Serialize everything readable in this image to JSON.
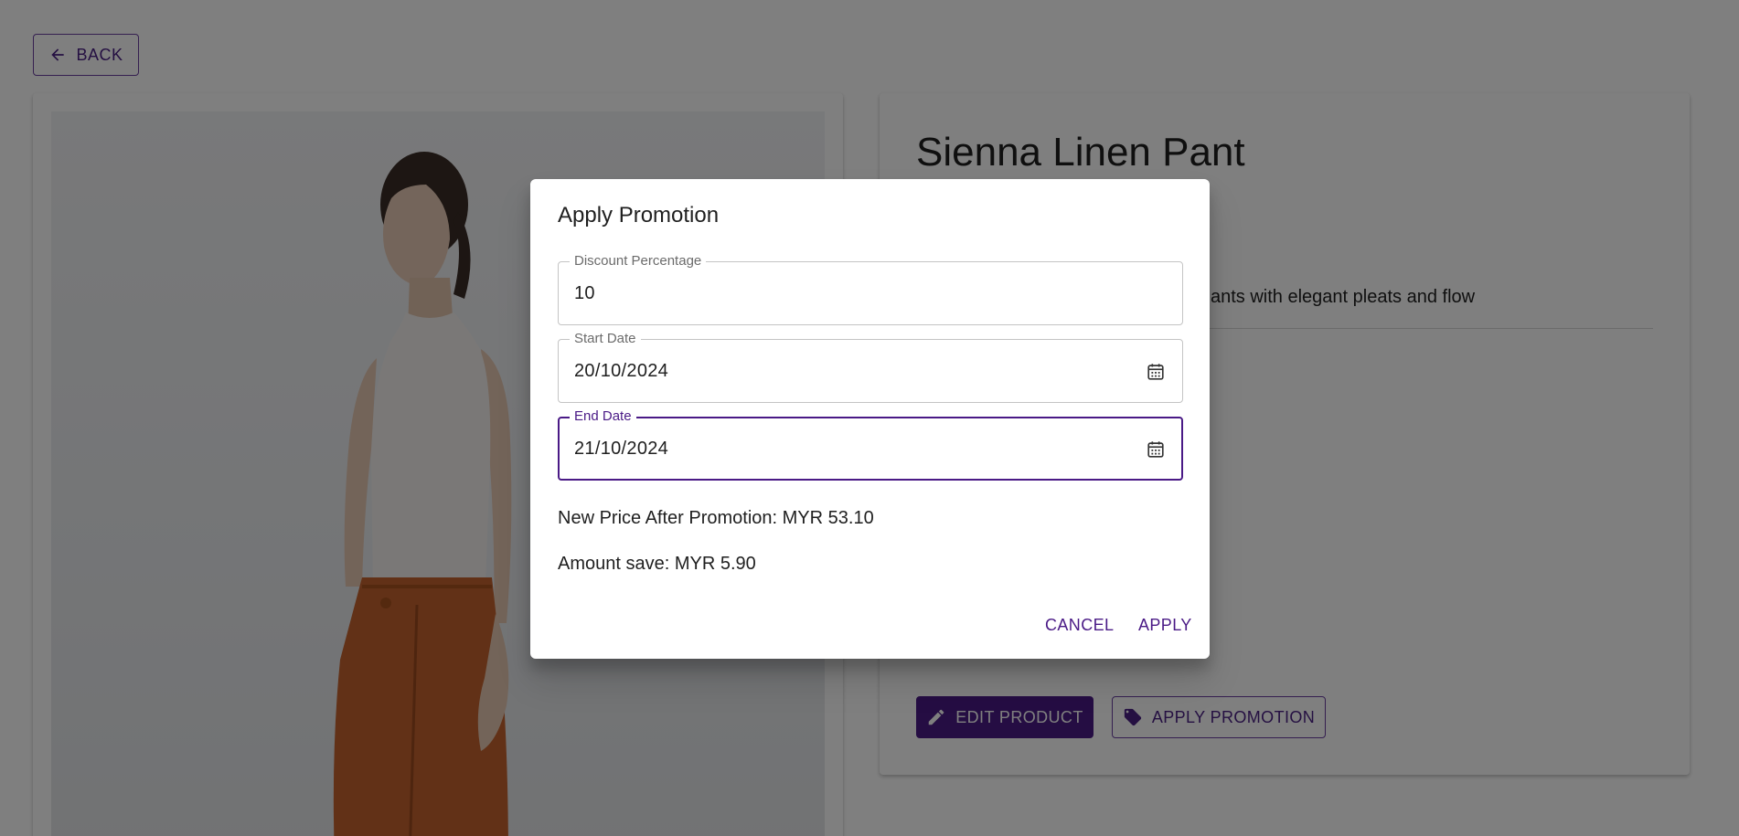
{
  "nav": {
    "back_label": "BACK"
  },
  "product": {
    "title": "Sienna Linen Pant",
    "description_visible": "ants with elegant pleats and flow",
    "edit_label": "EDIT PRODUCT",
    "promotion_label": "APPLY PROMOTION"
  },
  "dialog": {
    "title": "Apply Promotion",
    "discount": {
      "label": "Discount Percentage",
      "value": "10"
    },
    "start_date": {
      "label": "Start Date",
      "value": "20/10/2024"
    },
    "end_date": {
      "label": "End Date",
      "value": "21/10/2024"
    },
    "new_price_text": "New Price After Promotion: MYR 53.10",
    "amount_save_text": "Amount save: MYR 5.90",
    "cancel_label": "CANCEL",
    "apply_label": "APPLY"
  },
  "colors": {
    "primary": "#4a1a86",
    "backdrop": "rgba(0,0,0,0.5)"
  },
  "icons": {
    "back": "arrow-left-icon",
    "edit": "pencil-icon",
    "promotion": "tag-icon",
    "calendar": "calendar-icon"
  }
}
